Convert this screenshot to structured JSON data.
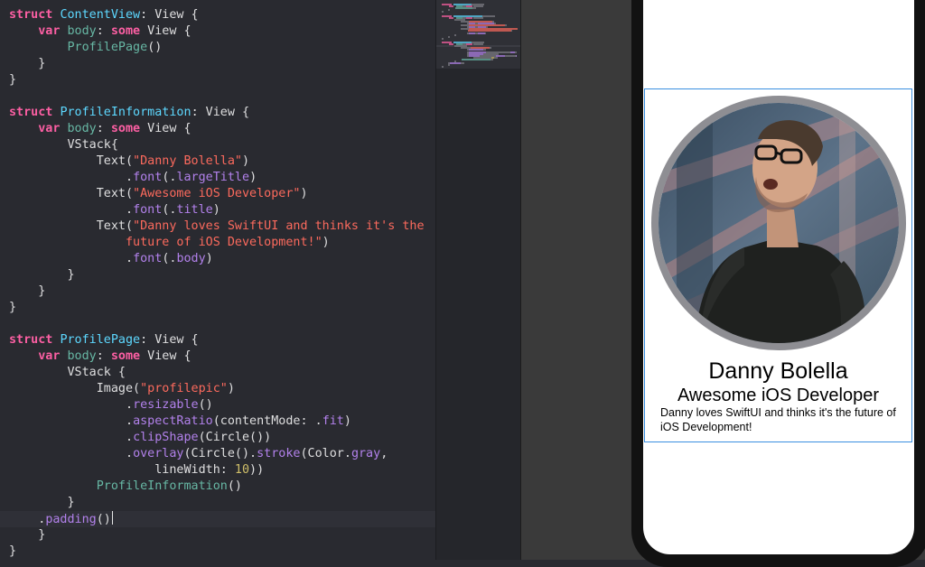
{
  "editor": {
    "lines": [
      [
        {
          "t": "struct",
          "k": "kw"
        },
        {
          "t": " ",
          "k": "pl"
        },
        {
          "t": "ContentView",
          "k": "type"
        },
        {
          "t": ": View {",
          "k": "pl"
        }
      ],
      [
        {
          "t": "    ",
          "k": "pl"
        },
        {
          "t": "var",
          "k": "kw"
        },
        {
          "t": " ",
          "k": "pl"
        },
        {
          "t": "body",
          "k": "ident"
        },
        {
          "t": ": ",
          "k": "pl"
        },
        {
          "t": "some",
          "k": "kw"
        },
        {
          "t": " View {",
          "k": "pl"
        }
      ],
      [
        {
          "t": "        ",
          "k": "pl"
        },
        {
          "t": "ProfilePage",
          "k": "ident"
        },
        {
          "t": "()",
          "k": "pl"
        }
      ],
      [
        {
          "t": "    }",
          "k": "pl"
        }
      ],
      [
        {
          "t": "}",
          "k": "pl"
        }
      ],
      [],
      [
        {
          "t": "struct",
          "k": "kw"
        },
        {
          "t": " ",
          "k": "pl"
        },
        {
          "t": "ProfileInformation",
          "k": "type"
        },
        {
          "t": ": View {",
          "k": "pl"
        }
      ],
      [
        {
          "t": "    ",
          "k": "pl"
        },
        {
          "t": "var",
          "k": "kw"
        },
        {
          "t": " ",
          "k": "pl"
        },
        {
          "t": "body",
          "k": "ident"
        },
        {
          "t": ": ",
          "k": "pl"
        },
        {
          "t": "some",
          "k": "kw"
        },
        {
          "t": " View {",
          "k": "pl"
        }
      ],
      [
        {
          "t": "        VStack{",
          "k": "pl"
        }
      ],
      [
        {
          "t": "            Text(",
          "k": "pl"
        },
        {
          "t": "\"Danny Bolella\"",
          "k": "str"
        },
        {
          "t": ")",
          "k": "pl"
        }
      ],
      [
        {
          "t": "                .",
          "k": "pl"
        },
        {
          "t": "font",
          "k": "fn"
        },
        {
          "t": "(.",
          "k": "pl"
        },
        {
          "t": "largeTitle",
          "k": "fn"
        },
        {
          "t": ")",
          "k": "pl"
        }
      ],
      [
        {
          "t": "            Text(",
          "k": "pl"
        },
        {
          "t": "\"Awesome iOS Developer\"",
          "k": "str"
        },
        {
          "t": ")",
          "k": "pl"
        }
      ],
      [
        {
          "t": "                .",
          "k": "pl"
        },
        {
          "t": "font",
          "k": "fn"
        },
        {
          "t": "(.",
          "k": "pl"
        },
        {
          "t": "title",
          "k": "fn"
        },
        {
          "t": ")",
          "k": "pl"
        }
      ],
      [
        {
          "t": "            Text(",
          "k": "pl"
        },
        {
          "t": "\"Danny loves SwiftUI and thinks it's the",
          "k": "str"
        }
      ],
      [
        {
          "t": "                ",
          "k": "pl"
        },
        {
          "t": "future of iOS Development!\"",
          "k": "str"
        },
        {
          "t": ")",
          "k": "pl"
        }
      ],
      [
        {
          "t": "                .",
          "k": "pl"
        },
        {
          "t": "font",
          "k": "fn"
        },
        {
          "t": "(.",
          "k": "pl"
        },
        {
          "t": "body",
          "k": "fn"
        },
        {
          "t": ")",
          "k": "pl"
        }
      ],
      [
        {
          "t": "        }",
          "k": "pl"
        }
      ],
      [
        {
          "t": "    }",
          "k": "pl"
        }
      ],
      [
        {
          "t": "}",
          "k": "pl"
        }
      ],
      [],
      [
        {
          "t": "struct",
          "k": "kw"
        },
        {
          "t": " ",
          "k": "pl"
        },
        {
          "t": "ProfilePage",
          "k": "type"
        },
        {
          "t": ": View {",
          "k": "pl"
        }
      ],
      [
        {
          "t": "    ",
          "k": "pl"
        },
        {
          "t": "var",
          "k": "kw"
        },
        {
          "t": " ",
          "k": "pl"
        },
        {
          "t": "body",
          "k": "ident"
        },
        {
          "t": ": ",
          "k": "pl"
        },
        {
          "t": "some",
          "k": "kw"
        },
        {
          "t": " View {",
          "k": "pl"
        }
      ],
      [
        {
          "t": "        VStack {",
          "k": "pl"
        }
      ],
      [
        {
          "t": "            Image(",
          "k": "pl"
        },
        {
          "t": "\"profilepic\"",
          "k": "str"
        },
        {
          "t": ")",
          "k": "pl"
        }
      ],
      [
        {
          "t": "                .",
          "k": "pl"
        },
        {
          "t": "resizable",
          "k": "fn"
        },
        {
          "t": "()",
          "k": "pl"
        }
      ],
      [
        {
          "t": "                .",
          "k": "pl"
        },
        {
          "t": "aspectRatio",
          "k": "fn"
        },
        {
          "t": "(contentMode: .",
          "k": "pl"
        },
        {
          "t": "fit",
          "k": "fn"
        },
        {
          "t": ")",
          "k": "pl"
        }
      ],
      [
        {
          "t": "                .",
          "k": "pl"
        },
        {
          "t": "clipShape",
          "k": "fn"
        },
        {
          "t": "(Circle())",
          "k": "pl"
        }
      ],
      [
        {
          "t": "                .",
          "k": "pl"
        },
        {
          "t": "overlay",
          "k": "fn"
        },
        {
          "t": "(Circle().",
          "k": "pl"
        },
        {
          "t": "stroke",
          "k": "fn"
        },
        {
          "t": "(Color.",
          "k": "pl"
        },
        {
          "t": "gray",
          "k": "fn"
        },
        {
          "t": ",",
          "k": "pl"
        }
      ],
      [
        {
          "t": "                    lineWidth: ",
          "k": "pl"
        },
        {
          "t": "10",
          "k": "num"
        },
        {
          "t": "))",
          "k": "pl"
        }
      ],
      [
        {
          "t": "            ",
          "k": "pl"
        },
        {
          "t": "ProfileInformation",
          "k": "ident"
        },
        {
          "t": "()",
          "k": "pl"
        }
      ],
      [
        {
          "t": "        }",
          "k": "pl"
        }
      ],
      [
        {
          "t": "    .",
          "k": "pl"
        },
        {
          "t": "padding",
          "k": "fn"
        },
        {
          "t": "()",
          "k": "pl"
        },
        {
          "t": "",
          "k": "caret"
        }
      ],
      [
        {
          "t": "    }",
          "k": "pl"
        }
      ],
      [
        {
          "t": "}",
          "k": "pl"
        }
      ]
    ]
  },
  "preview": {
    "name": "Danny Bolella",
    "subtitle": "Awesome iOS Developer",
    "bio": "Danny loves SwiftUI and thinks it's the future of iOS Development!",
    "image_name": "profilepic"
  },
  "colors": {
    "editor_bg": "#292a30",
    "keyword": "#fc5fa3",
    "type": "#5dd8ff",
    "identifier": "#67b7a4",
    "function": "#b281eb",
    "string": "#fc6a5d",
    "number": "#d0bf69",
    "selection_outline": "#3a8fe0",
    "stroke_gray": "#8e8e93"
  }
}
